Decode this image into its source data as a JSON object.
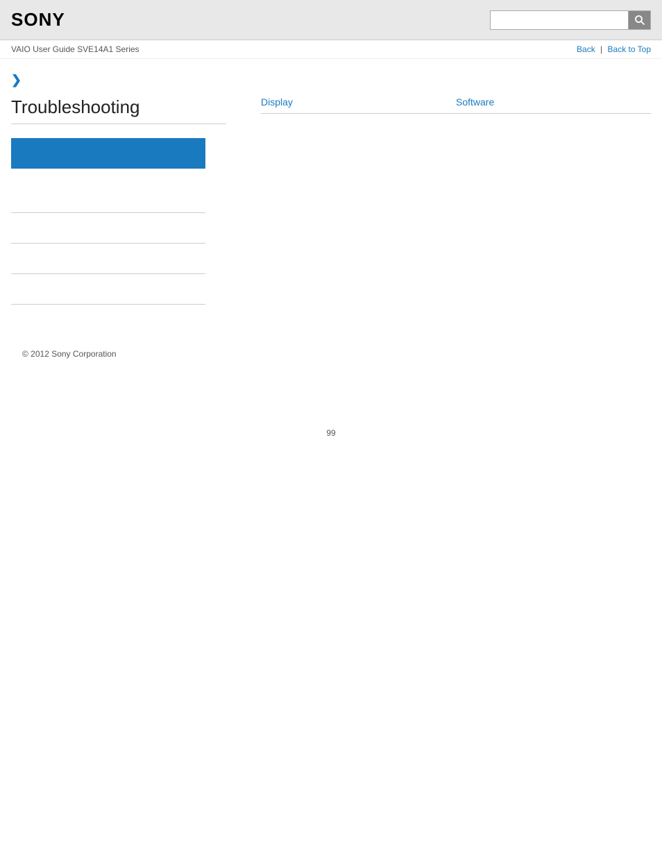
{
  "header": {
    "logo": "SONY",
    "search_placeholder": ""
  },
  "nav": {
    "breadcrumb": "VAIO User Guide SVE14A1 Series",
    "back_label": "Back",
    "separator": "|",
    "back_to_top_label": "Back to Top"
  },
  "main": {
    "chevron": "❯",
    "section_title": "Troubleshooting",
    "right_links": [
      {
        "label": "Display"
      },
      {
        "label": "Software"
      }
    ]
  },
  "footer": {
    "copyright": "© 2012 Sony Corporation"
  },
  "page": {
    "number": "99"
  },
  "icons": {
    "search": "🔍"
  }
}
